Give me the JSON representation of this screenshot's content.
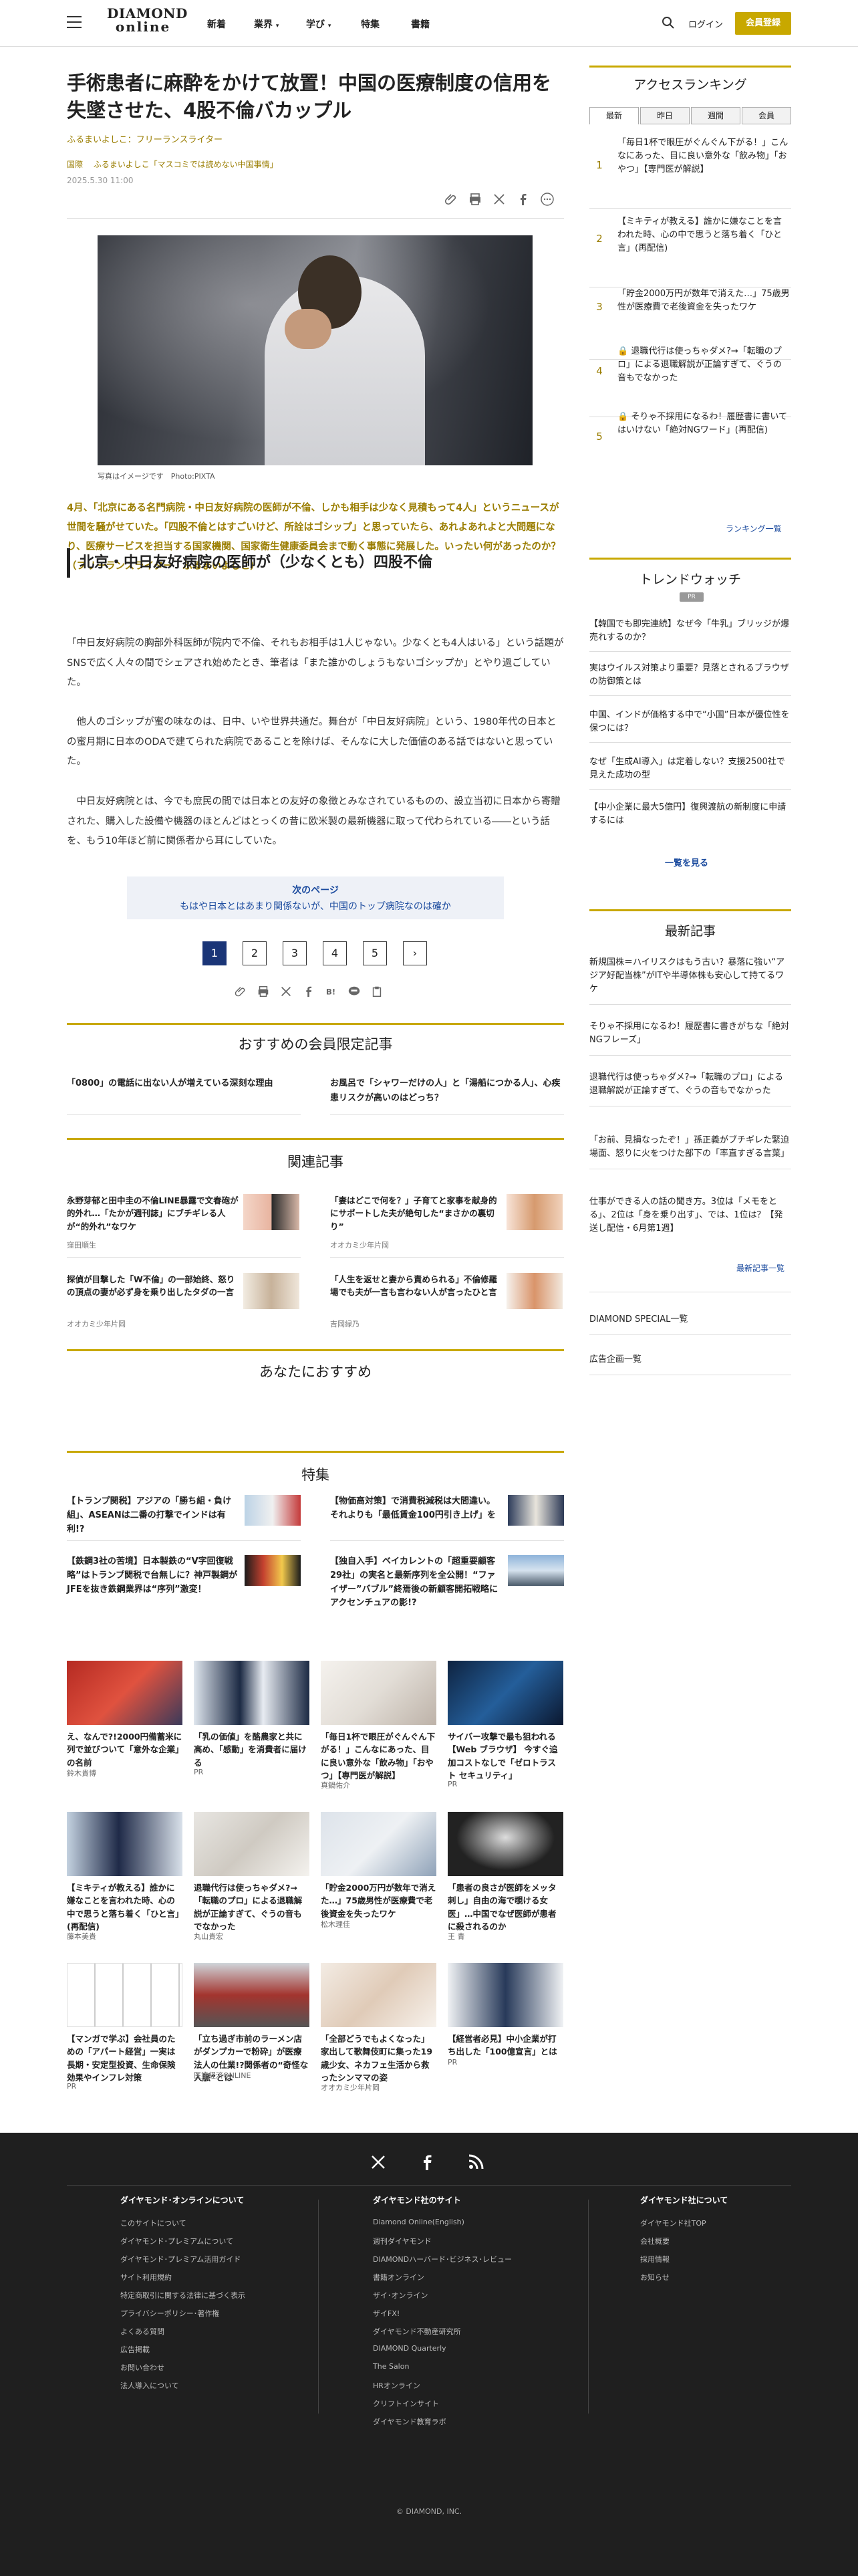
{
  "header": {
    "logo_top": "DIAMOND",
    "logo_bottom": "online",
    "nav": [
      "新着",
      "業界",
      "学び",
      "特集",
      "書籍"
    ],
    "login": "ログイン",
    "register": "会員登録"
  },
  "article": {
    "title": "手術患者に麻酔をかけて放置！中国の医療制度の信用を失墜させた、4股不倫バカップル",
    "author": "ふるまいよしこ：フリーランスライター",
    "categories": [
      "国際",
      "ふるまいよしこ「マスコミでは読めない中国事情」"
    ],
    "date": "2025.5.30 11:00",
    "photo_caption": "写真はイメージです　Photo:PIXTA",
    "lead": "4月、「北京にある名門病院・中日友好病院の医師が不倫、しかも相手は少なく見積もって4人」というニュースが世間を騒がせていた。「四股不倫とはすごいけど、所詮はゴシップ」と思っていたら、あれよあれよと大問題になり、医療サービスを担当する国家機関、国家衛生健康委員会まで動く事態に発展した。いったい何があったのか？（フリーランスライター　ふるまいよしこ）",
    "heading": "北京・中日友好病院の医師が（少なくとも）四股不倫",
    "paragraphs": [
      "「中日友好病院の胸部外科医師が院内で不倫、それもお相手は1人じゃない。少なくとも4人はいる」という話題がSNSで広く人々の間でシェアされ始めたとき、筆者は「また誰かのしょうもないゴシップか」とやり過ごしていた。",
      "他人のゴシップが蜜の味なのは、日中、いや世界共通だ。舞台が「中日友好病院」という、1980年代の日本との蜜月期に日本のODAで建てられた病院であることを除けば、そんなに大した価値のある話ではないと思っていた。",
      "中日友好病院とは、今でも庶民の間では日本との友好の象徴とみなされているものの、設立当初に日本から寄贈された、購入した設備や機器のほとんどはとっくの昔に欧米製の最新機器に取って代わられている――という話を、もう10年ほど前に関係者から耳にしていた。"
    ],
    "next_label": "次のページ",
    "next_title": "もはや日本とはあまり関係ないが、中国のトップ病院なのは確か",
    "pages": [
      "1",
      "2",
      "3",
      "4",
      "5",
      "›"
    ]
  },
  "members": {
    "title": "おすすめの会員限定記事",
    "items": [
      "「0800」の電話に出ない人が増えている深刻な理由",
      "お風呂で「シャワーだけの人」と「湯船につかる人」、心疾患リスクが高いのはどっち？"
    ]
  },
  "related": {
    "title": "関連記事",
    "items": [
      {
        "title": "永野芽郁と田中圭の不倫LINE暴露で文春砲が的外れ…「たかが週刊誌」にブチギレる人が“的外れ”なワケ",
        "author": "窪田順生"
      },
      {
        "title": "「妻はどこで何を？」子育てと家事を献身的にサポートした夫が絶句した“まさかの裏切り”",
        "author": "オオカミ少年片岡"
      },
      {
        "title": "探偵が目撃した「W不倫」の一部始終、怒りの頂点の妻が必ず身を乗り出したタダの一言",
        "author": "オオカミ少年片岡"
      },
      {
        "title": "「人生を返せと妻から責められる」不倫修羅場でも夫が一言も言わない人が言ったひと言",
        "author": "吉岡緑乃"
      }
    ]
  },
  "foryou": {
    "title": "あなたにおすすめ"
  },
  "tokushu": {
    "title": "特集",
    "items": [
      "【トランプ関税】アジアの「勝ち組・負け組」、ASEANは二番の打撃でインドは有利!?",
      "【物価高対策】で消費税減税は大間違い。それよりも「最低賃金100円引き上げ」を",
      "【鉄鋼3社の苦境】日本製鉄の“V字回復戦略”はトランプ関税で台無しに？神戸製鋼がJFEを抜き鉄鋼業界は“序列”激変！",
      "【独自入手】ベイカレントの「超重要顧客29社」の実名と最新序列を全公開！“ファイザー”バブル”終焉後の新顧客開拓戦略にアクセンチュアの影!?"
    ]
  },
  "cards": [
    {
      "title": "え、なんで?!2000円備蓄米に列で並びついて「意外な企業」の名前",
      "author": "鈴木貴博"
    },
    {
      "title": "「乳の価値」を酪農家と共に高め、「感動」を消費者に届ける",
      "author": "PR"
    },
    {
      "title": "「毎日1杯で眼圧がぐんぐん下がる！」こんなにあった、目に良い意外な「飲み物」「おやつ」【専門医が解説】",
      "author": "真鍋佑介"
    },
    {
      "title": "サイバー攻撃で最も狙われる【Web ブラウザ】 今すぐ追加コストなしで「ゼロトラスト セキュリティ」",
      "author": "PR"
    },
    {
      "title": "【ミキティが教える】誰かに嫌なことを言われた時、心の中で思うと落ち着く「ひと言」(再配信)",
      "author": "藤本美貴"
    },
    {
      "title": "退職代行は使っちゃダメ?→「転職のプロ」による退職解説が正論すぎて、ぐうの音もでなかった",
      "author": "丸山貴宏"
    },
    {
      "title": "「貯金2000万円が数年で消えた…」75歳男性が医療費で老後資金を失ったワケ",
      "author": "松木理佳"
    },
    {
      "title": "「患者の良さが医師をメッタ刺し」自由の海で覗ける女医」…中国でなぜ医師が患者に殺されるのか",
      "author": "王 青"
    },
    {
      "title": "【マンガで学ぶ】会社員のための「アパート経営」一実は長期・安定型投資、生命保険効果やインフレ対策",
      "author": "PR"
    },
    {
      "title": "「立ち過ぎ市前のラーメン店がダンプカーで粉砕」が医療法人の仕業!?関係者の“奇怪な人脈”とは",
      "author": "医業経済ONLINE"
    },
    {
      "title": "「全部どうでもよくなった」家出して歌舞伎町に集った19歳少女、ネカフェ生活から救ったシンママの姿",
      "author": "オオカミ少年片岡"
    },
    {
      "title": "【経営者必見】中小企業が打ち出した「100億宣言」とは",
      "author": "PR"
    }
  ],
  "sidebar": {
    "ranking_title": "アクセスランキング",
    "tabs": [
      "最新",
      "昨日",
      "週間",
      "会員"
    ],
    "ranking": [
      {
        "rank": "1",
        "text": "「毎日1杯で眼圧がぐんぐん下がる！」こんなにあった、目に良い意外な「飲み物」「おやつ」【専門医が解説】"
      },
      {
        "rank": "2",
        "text": "【ミキティが教える】誰かに嫌なことを言われた時、心の中で思うと落ち着く「ひと言」(再配信)"
      },
      {
        "rank": "3",
        "text": "「貯金2000万円が数年で消えた…」75歳男性が医療費で老後資金を失ったワケ"
      },
      {
        "rank": "4",
        "text": "退職代行は使っちゃダメ?→「転職のプロ」による退職解説が正論すぎて、ぐうの音もでなかった"
      },
      {
        "rank": "5",
        "text": "そりゃ不採用になるわ！履歴書に書いてはいけない「絶対NGワード」(再配信)"
      }
    ],
    "ranking_more": "ランキング一覧",
    "trend_title": "トレンドウォッチ",
    "trend_pr": "PR",
    "trend": [
      "【韓国でも即完連続】なぜ今「牛乳」ブリッジが爆売れするのか？",
      "実はウイルス対策より重要？見落とされるブラウザの防御策とは",
      "中国、インドが価格する中で“小国”日本が優位性を保つには？",
      "なぜ「生成AI導入」は定着しない？支援2500社で見えた成功の型",
      "【中小企業に最大5億円】復興渡航の新制度に申請するには"
    ],
    "trend_more": "一覧を見る",
    "latest_title": "最新記事",
    "latest": [
      "新規国株＝ハイリスクはもう古い？暴落に強い“アジア好配当株”がITや半導体株も安心して持てるワケ",
      "そりゃ不採用になるわ！履歴書に書きがちな「絶対NGフレーズ」",
      "退職代行は使っちゃダメ?→「転職のプロ」による退職解説が正論すぎて、ぐうの音もでなかった",
      "「お前、見損なったぞ！」孫正義がブチギレた緊迫場面、怒りに火をつけた部下の「率直すぎる言葉」",
      "仕事ができる人の話の聞き方。3位は「メモをとる」、2位は「身を乗り出す」、では、1位は？【発送し配信・6月第1週】"
    ],
    "latest_more": "最新記事一覧",
    "special": "DIAMOND SPECIAL一覧",
    "ad": "広告企画一覧"
  },
  "footer": {
    "col1_title": "ダイヤモンド･オンラインについて",
    "col1": [
      "このサイトについて",
      "ダイヤモンド･プレミアムについて",
      "ダイヤモンド･プレミアム活用ガイド",
      "サイト利用規約",
      "特定商取引に関する法律に基づく表示",
      "プライバシーポリシー･著作権",
      "よくある質問",
      "広告掲載",
      "お問い合わせ",
      "法人導入について"
    ],
    "col2_title": "ダイヤモンド社のサイト",
    "col2": [
      "Diamond Online(English)",
      "週刊ダイヤモンド",
      "DIAMONDハーバード･ビジネス･レビュー",
      "書籍オンライン",
      "ザイ･オンライン",
      "ザイFX!",
      "ダイヤモンド不動産研究所",
      "DIAMOND Quarterly",
      "The Salon",
      "HRオンライン",
      "クリフトインサイト",
      "ダイヤモンド教育ラボ"
    ],
    "col3_title": "ダイヤモンド社について",
    "col3": [
      "ダイヤモンド社TOP",
      "会社概要",
      "採用情報",
      "お知らせ"
    ],
    "copyright": "© DIAMOND, INC."
  },
  "colors": {
    "accent": "#c8a800",
    "link": "#1a4a9e",
    "navy": "#1a3577",
    "footer": "#1f1f1f"
  }
}
